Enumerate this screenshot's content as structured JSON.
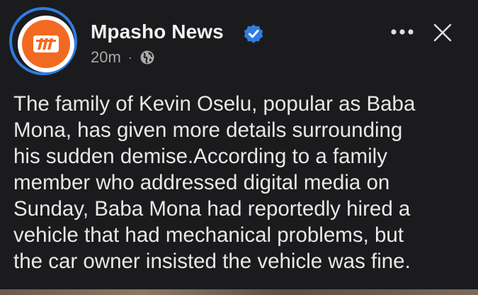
{
  "post": {
    "author": "Mpasho News",
    "timestamp": "20m",
    "separator": "·",
    "audience_icon": "globe-icon",
    "verified_icon": "verified-badge-icon",
    "more_icon": "more-options-icon",
    "close_icon": "close-icon",
    "logo_text": "m",
    "text_lines": [
      "The family of Kevin Oselu, popular as Baba",
      "Mona, has given more details surrounding",
      "his sudden demise.According to a family",
      "member who addressed digital media on",
      "Sunday, Baba Mona had reportedly hired a",
      "vehicle that had mechanical problems, but",
      "the car owner insisted the vehicle was fine."
    ]
  },
  "colors": {
    "background": "#1b1b1d",
    "avatar_ring": "#2f7de0",
    "logo_orange": "#f26a21",
    "verified_blue": "#2f7de0",
    "text_primary": "#e8e8e8",
    "text_secondary": "#a8a8a8"
  }
}
